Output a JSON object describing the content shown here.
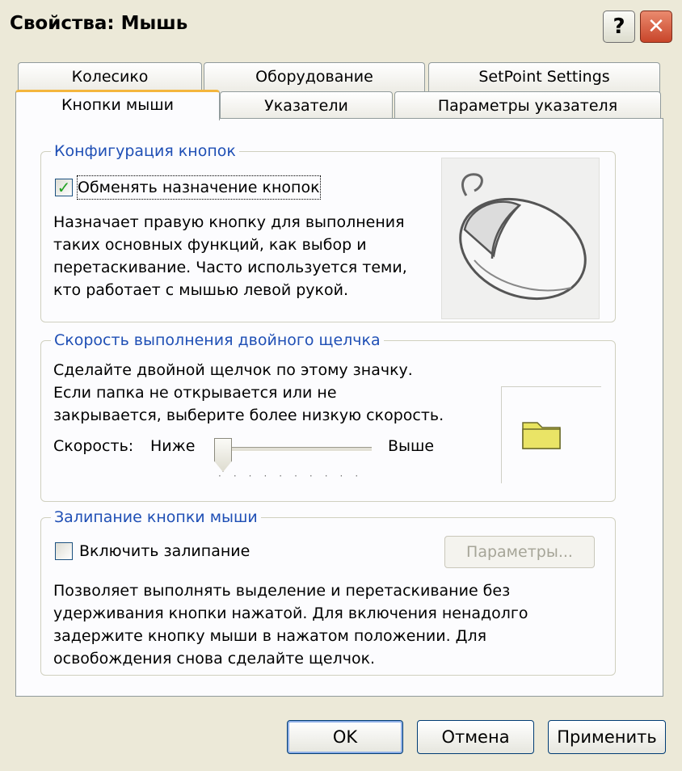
{
  "window": {
    "title": "Свойства: Мышь",
    "help_label": "?",
    "close_label": "✕"
  },
  "tabs_top": [
    {
      "label": "Колесико"
    },
    {
      "label": "Оборудование"
    },
    {
      "label": "SetPoint Settings"
    }
  ],
  "tabs_bottom": [
    {
      "label": "Кнопки мыши",
      "active": true
    },
    {
      "label": "Указатели"
    },
    {
      "label": "Параметры указателя"
    }
  ],
  "button_config": {
    "legend": "Конфигурация кнопок",
    "swap_checkbox_label": "Обменять назначение кнопок",
    "swap_checked": true,
    "description": [
      "Назначает правую кнопку для выполнения",
      "таких основных функций, как выбор и",
      "перетаскивание. Часто используется теми,",
      "кто работает с мышью левой рукой."
    ]
  },
  "double_click": {
    "legend": "Скорость выполнения двойного щелчка",
    "description": [
      "Сделайте двойной щелчок по этому значку.",
      "Если папка не открывается или не",
      "закрывается, выберите более низкую скорость."
    ],
    "speed_label": "Скорость:",
    "slow_label": "Ниже",
    "fast_label": "Выше",
    "slider_value": 0.0,
    "tick_marks": "··········"
  },
  "click_lock": {
    "legend": "Залипание кнопки мыши",
    "checkbox_label": "Включить залипание",
    "checked": false,
    "settings_button_label": "Параметры...",
    "description": [
      "Позволяет выполнять выделение и перетаскивание без",
      "удерживания кнопки нажатой. Для включения ненадолго",
      "задержите кнопку мыши в нажатом положении. Для",
      "освобождения снова сделайте щелчок."
    ]
  },
  "footer": {
    "ok_label": "OK",
    "cancel_label": "Отмена",
    "apply_label": "Применить"
  },
  "colors": {
    "background": "#ece9d8",
    "legend_blue": "#1f4fb5",
    "check_green": "#21a121",
    "folder_yellow": "#e9e45f",
    "close_red": "#d0492b"
  }
}
